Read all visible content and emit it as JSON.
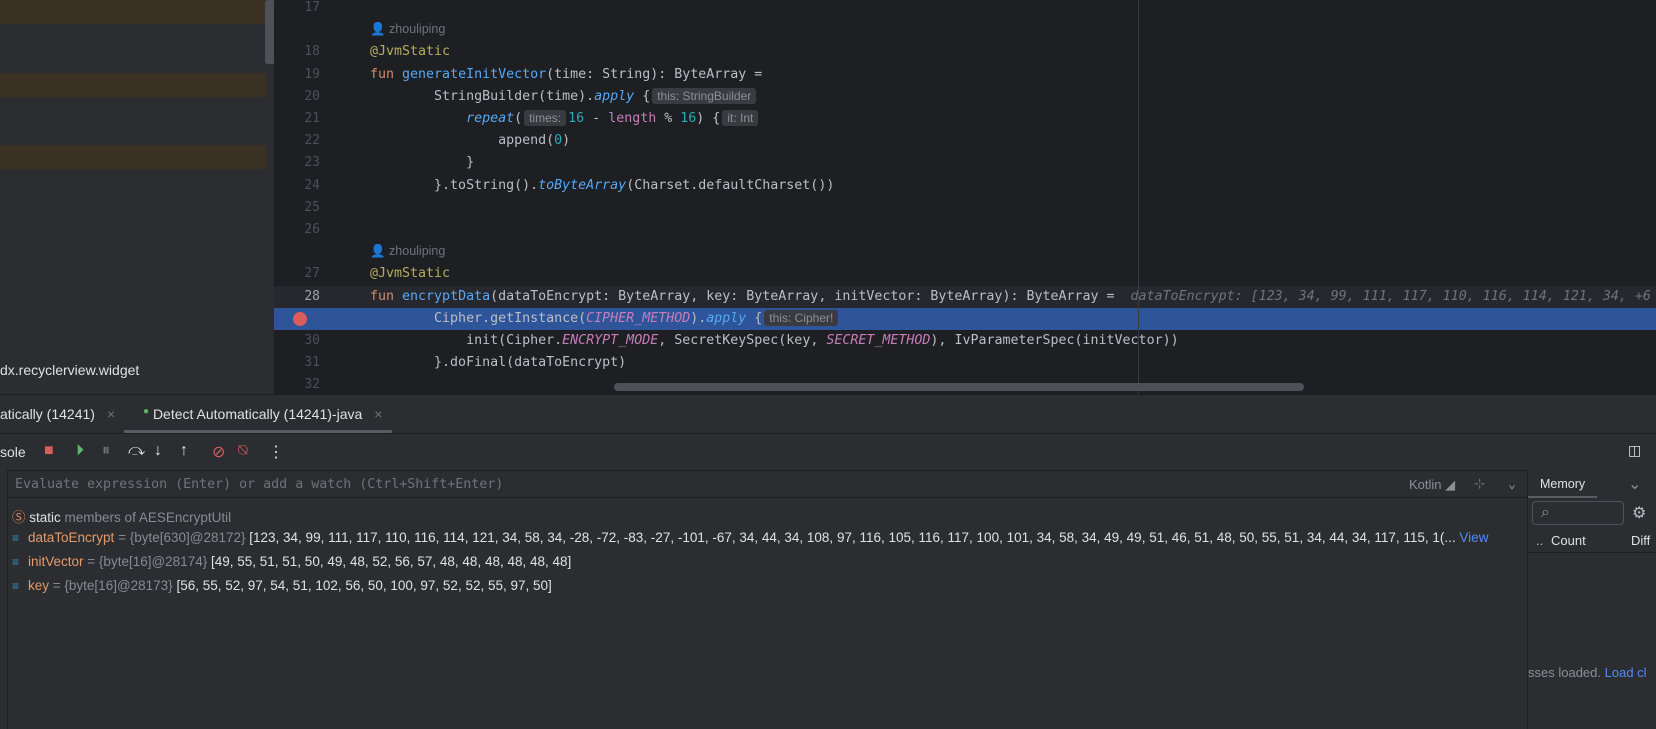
{
  "project": {
    "visible_label": "dx.recyclerview.widget"
  },
  "editor": {
    "lines": [
      {
        "n": "17",
        "t": []
      },
      {
        "n": "",
        "author": "zhouliping"
      },
      {
        "n": "18",
        "t": [
          [
            "@JvmStatic",
            "an"
          ]
        ]
      },
      {
        "n": "19",
        "t": [
          [
            "fun ",
            "kw"
          ],
          [
            "generateInitVector",
            "fn"
          ],
          [
            "(time: String): ByteArray =",
            ""
          ]
        ]
      },
      {
        "n": "20",
        "t": [
          [
            "        StringBuilder(time).",
            ""
          ],
          [
            "apply",
            "ext"
          ],
          [
            " {",
            ""
          ],
          [
            "this: StringBuilder",
            "hint"
          ]
        ]
      },
      {
        "n": "21",
        "t": [
          [
            "            ",
            ""
          ],
          [
            "repeat",
            "ext"
          ],
          [
            "(",
            ""
          ],
          [
            "times:",
            "hint"
          ],
          [
            "16",
            "num"
          ],
          [
            " - ",
            ""
          ],
          [
            "length",
            "prop"
          ],
          [
            " % ",
            ""
          ],
          [
            "16",
            "num"
          ],
          [
            ") {",
            ""
          ],
          [
            "it: Int",
            "hint"
          ]
        ]
      },
      {
        "n": "22",
        "t": [
          [
            "                append(",
            ""
          ],
          [
            "0",
            "num"
          ],
          [
            ")",
            ""
          ]
        ]
      },
      {
        "n": "23",
        "t": [
          [
            "            }",
            ""
          ]
        ]
      },
      {
        "n": "24",
        "t": [
          [
            "        }.toString().",
            ""
          ],
          [
            "toByteArray",
            "ext"
          ],
          [
            "(Charset.defaultCharset())",
            ""
          ]
        ]
      },
      {
        "n": "25",
        "t": []
      },
      {
        "n": "26",
        "t": []
      },
      {
        "n": "",
        "author": "zhouliping"
      },
      {
        "n": "27",
        "t": [
          [
            "@JvmStatic",
            "an"
          ]
        ]
      },
      {
        "n": "28",
        "cur": true,
        "t": [
          [
            "fun ",
            "kw"
          ],
          [
            "encryptData",
            "fn"
          ],
          [
            "(dataToEncrypt: ByteArray, key: ByteArray, initVector: ByteArray): ByteArray =  ",
            ""
          ],
          [
            "dataToEncrypt: [123, 34, 99, 111, 117, 110, 116, 114, 121, 34, +6",
            "inl"
          ]
        ]
      },
      {
        "n": "",
        "bp": true,
        "hl": true,
        "t": [
          [
            "        Cipher.getInstance(",
            ""
          ],
          [
            "CIPHER_METHOD",
            "cst"
          ],
          [
            ").",
            ""
          ],
          [
            "apply",
            "ext"
          ],
          [
            " {",
            ""
          ],
          [
            "this: Cipher!",
            "hint"
          ]
        ]
      },
      {
        "n": "30",
        "t": [
          [
            "            init(Cipher.",
            ""
          ],
          [
            "ENCRYPT_MODE",
            "cst"
          ],
          [
            ", SecretKeySpec(key, ",
            ""
          ],
          [
            "SECRET_METHOD",
            "cst"
          ],
          [
            "), IvParameterSpec(initVector))",
            ""
          ]
        ]
      },
      {
        "n": "31",
        "t": [
          [
            "        }.doFinal(dataToEncrypt)",
            ""
          ]
        ]
      },
      {
        "n": "32",
        "t": []
      }
    ]
  },
  "debug": {
    "tabs": [
      "atically (14241)",
      "Detect Automatically (14241)-java"
    ],
    "console_label": "sole",
    "eval_placeholder": "Evaluate expression (Enter) or add a watch (Ctrl+Shift+Enter)",
    "language": "Kotlin",
    "static_label": "static",
    "static_rest": "members of AESEncryptUtil",
    "variables": [
      {
        "name": "dataToEncrypt",
        "type": "{byte[630]@28172}",
        "value": "[123, 34, 99, 111, 117, 110, 116, 114, 121, 34, 58, 34, -28, -72, -83, -27, -101, -67, 34, 44, 34, 108, 97, 116, 105, 116, 117, 100, 101, 34, 58, 34, 49, 49, 51, 46, 51, 48, 50, 55, 51, 34, 44, 34, 117, 115, 1(...",
        "link": "View"
      },
      {
        "name": "initVector",
        "type": "{byte[16]@28174}",
        "value": "[49, 55, 51, 51, 50, 49, 48, 52, 56, 57, 48, 48, 48, 48, 48, 48]"
      },
      {
        "name": "key",
        "type": "{byte[16]@28173}",
        "value": "[56, 55, 52, 97, 54, 51, 102, 56, 50, 100, 97, 52, 52, 55, 97, 50]"
      }
    ]
  },
  "memory": {
    "tab": "Memory",
    "col_dots": "..",
    "col_count": "Count",
    "col_diff": "Diff",
    "status": "sses loaded.",
    "load_link": "Load cl"
  },
  "colors": {
    "breakpoint": "#db5c5c",
    "exec_line": "#2e5599",
    "link": "#548af7"
  }
}
